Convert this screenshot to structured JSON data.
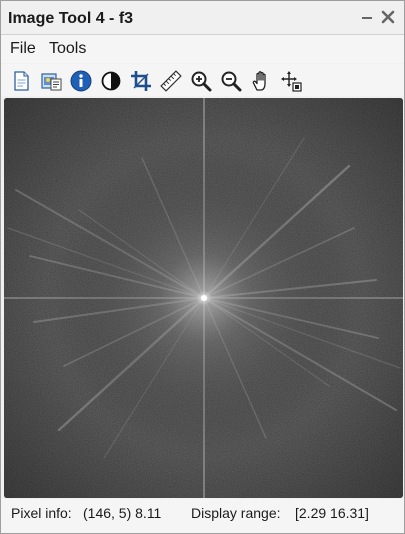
{
  "window": {
    "title": "Image Tool 4 - f3",
    "controls": {
      "minimize": "minimize-icon",
      "close": "close-icon"
    }
  },
  "menu": {
    "items": [
      {
        "label": "File"
      },
      {
        "label": "Tools"
      }
    ]
  },
  "toolbar": {
    "tools": [
      {
        "icon": "new-figure-icon"
      },
      {
        "icon": "image-information-icon"
      },
      {
        "icon": "pixel-info-icon"
      },
      {
        "icon": "adjust-contrast-icon"
      },
      {
        "icon": "crop-image-icon"
      },
      {
        "icon": "measure-distance-icon"
      },
      {
        "icon": "zoom-in-icon"
      },
      {
        "icon": "zoom-out-icon"
      },
      {
        "icon": "pan-icon"
      },
      {
        "icon": "pixel-region-icon"
      }
    ]
  },
  "image": {
    "description": "fourier-spectrum-image"
  },
  "status": {
    "pixel_info_label": "Pixel info:",
    "pixel_info_value": "(146, 5)  8.11",
    "display_range_label": "Display range:",
    "display_range_value": "[2.29 16.31]"
  }
}
